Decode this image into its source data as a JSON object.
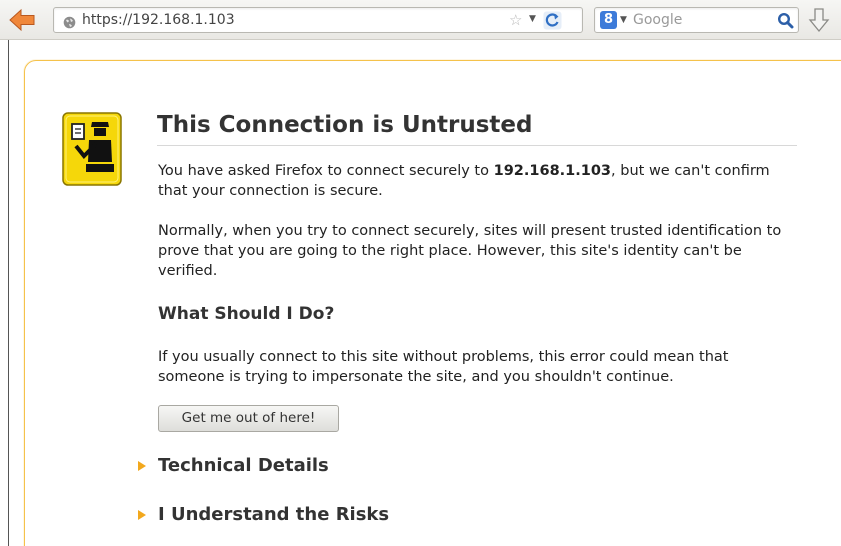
{
  "toolbar": {
    "url": "https://192.168.1.103",
    "search_placeholder": "Google",
    "icons": {
      "back": "back-arrow-icon",
      "globe": "site-identity-icon",
      "star": "bookmark-star-icon",
      "reload": "reload-icon",
      "engine": "google-engine-icon",
      "search": "search-magnifier-icon",
      "downloads": "download-arrow-icon"
    }
  },
  "error_page": {
    "title": "This Connection is Untrusted",
    "intro_prefix": "You have asked Firefox to connect securely to ",
    "intro_host": "192.168.1.103",
    "intro_suffix": ", but we can't confirm that your connection is secure.",
    "normal_text": "Normally, when you try to connect securely, sites will present trusted identification to prove that you are going to the right place. However, this site's identity can't be verified.",
    "what_heading": "What Should I Do?",
    "what_text": "If you usually connect to this site without problems, this error could mean that someone is trying to impersonate the site, and you shouldn't continue.",
    "get_out_button": "Get me out of here!",
    "technical_details": "Technical Details",
    "understand_risks": "I Understand the Risks"
  },
  "colors": {
    "accent_yellow": "#f5c24b",
    "expander_triangle": "#f2a81d",
    "back_arrow": "#e07a2c",
    "icon_yellow": "#f4d400"
  }
}
